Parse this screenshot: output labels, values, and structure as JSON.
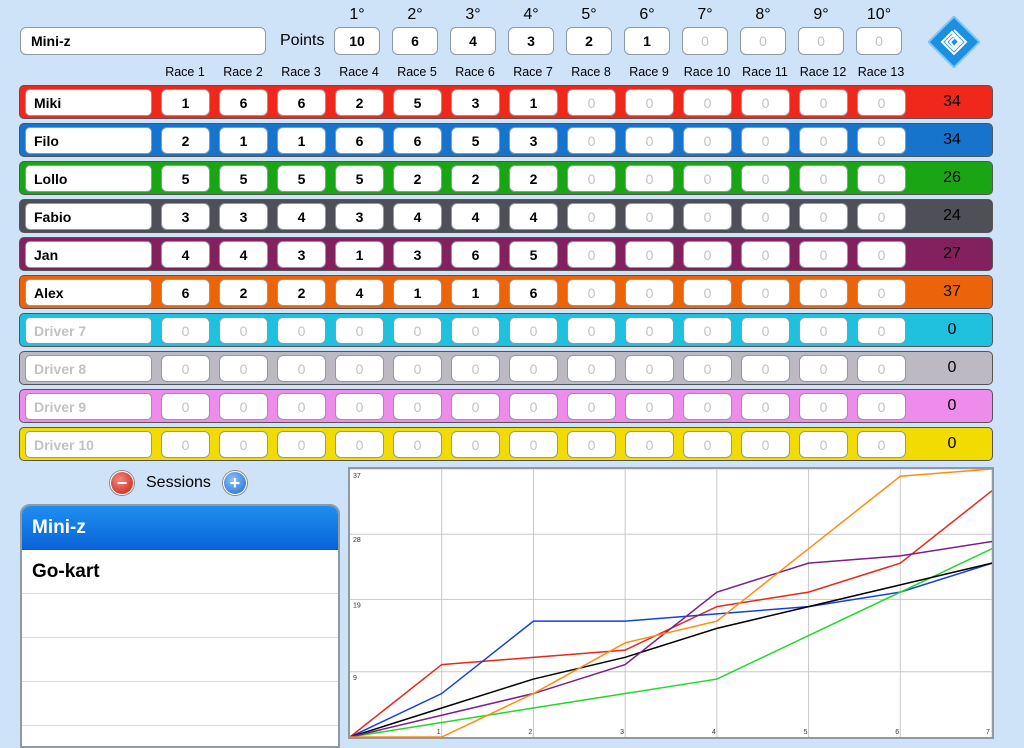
{
  "session": {
    "name": "Mini-z"
  },
  "points": {
    "label": "Points",
    "positions": [
      "1°",
      "2°",
      "3°",
      "4°",
      "5°",
      "6°",
      "7°",
      "8°",
      "9°",
      "10°"
    ],
    "values": [
      "10",
      "6",
      "4",
      "3",
      "2",
      "1",
      "0",
      "0",
      "0",
      "0"
    ]
  },
  "races": [
    "Race 1",
    "Race 2",
    "Race 3",
    "Race 4",
    "Race 5",
    "Race 6",
    "Race 7",
    "Race 8",
    "Race 9",
    "Race 10",
    "Race 11",
    "Race 12",
    "Race 13"
  ],
  "drivers": [
    {
      "name": "Miki",
      "color": "#f0281c",
      "results": [
        "1",
        "6",
        "6",
        "2",
        "5",
        "3",
        "1",
        "0",
        "0",
        "0",
        "0",
        "0",
        "0"
      ],
      "total": "34",
      "placeholder": false
    },
    {
      "name": "Filo",
      "color": "#1774cc",
      "results": [
        "2",
        "1",
        "1",
        "6",
        "6",
        "5",
        "3",
        "0",
        "0",
        "0",
        "0",
        "0",
        "0"
      ],
      "total": "34",
      "placeholder": false
    },
    {
      "name": "Lollo",
      "color": "#19a514",
      "results": [
        "5",
        "5",
        "5",
        "5",
        "2",
        "2",
        "2",
        "0",
        "0",
        "0",
        "0",
        "0",
        "0"
      ],
      "total": "26",
      "placeholder": false
    },
    {
      "name": "Fabio",
      "color": "#4f4f57",
      "results": [
        "3",
        "3",
        "4",
        "3",
        "4",
        "4",
        "4",
        "0",
        "0",
        "0",
        "0",
        "0",
        "0"
      ],
      "total": "24",
      "placeholder": false
    },
    {
      "name": "Jan",
      "color": "#83215e",
      "results": [
        "4",
        "4",
        "3",
        "1",
        "3",
        "6",
        "5",
        "0",
        "0",
        "0",
        "0",
        "0",
        "0"
      ],
      "total": "27",
      "placeholder": false
    },
    {
      "name": "Alex",
      "color": "#eb6409",
      "results": [
        "6",
        "2",
        "2",
        "4",
        "1",
        "1",
        "6",
        "0",
        "0",
        "0",
        "0",
        "0",
        "0"
      ],
      "total": "37",
      "placeholder": false
    },
    {
      "name": "Driver 7",
      "color": "#20c1df",
      "results": [
        "0",
        "0",
        "0",
        "0",
        "0",
        "0",
        "0",
        "0",
        "0",
        "0",
        "0",
        "0",
        "0"
      ],
      "total": "0",
      "placeholder": true
    },
    {
      "name": "Driver 8",
      "color": "#bcb9c3",
      "results": [
        "0",
        "0",
        "0",
        "0",
        "0",
        "0",
        "0",
        "0",
        "0",
        "0",
        "0",
        "0",
        "0"
      ],
      "total": "0",
      "placeholder": true
    },
    {
      "name": "Driver 9",
      "color": "#ee8cec",
      "results": [
        "0",
        "0",
        "0",
        "0",
        "0",
        "0",
        "0",
        "0",
        "0",
        "0",
        "0",
        "0",
        "0"
      ],
      "total": "0",
      "placeholder": true
    },
    {
      "name": "Driver 10",
      "color": "#f2db00",
      "results": [
        "0",
        "0",
        "0",
        "0",
        "0",
        "0",
        "0",
        "0",
        "0",
        "0",
        "0",
        "0",
        "0"
      ],
      "total": "0",
      "placeholder": true
    }
  ],
  "sessions": {
    "label": "Sessions",
    "items": [
      "Mini-z",
      "Go-kart"
    ],
    "selected": "Mini-z"
  },
  "icons": {
    "remove": "minus-circle-icon",
    "add": "plus-circle-icon",
    "logo": "diamond-spiral-icon"
  },
  "chart_data": {
    "type": "line",
    "x": [
      0,
      1,
      2,
      3,
      4,
      5,
      6,
      7
    ],
    "xticks": [
      "1",
      "2",
      "3",
      "4",
      "5",
      "6",
      "7"
    ],
    "yticks": [
      "9",
      "19",
      "28",
      "37"
    ],
    "ylim": [
      0,
      37
    ],
    "xlim": [
      0,
      7
    ],
    "grid": true,
    "series": [
      {
        "color": "#e8281b",
        "values": [
          0,
          10,
          11,
          12,
          18,
          20,
          24,
          34
        ]
      },
      {
        "color": "#1540e0",
        "values": [
          0,
          6,
          16,
          16,
          17,
          18,
          20,
          24
        ]
      },
      {
        "color": "#22d82a",
        "values": [
          0,
          2,
          4,
          6,
          8,
          14,
          20,
          26
        ]
      },
      {
        "color": "#000000",
        "values": [
          0,
          4,
          8,
          11,
          15,
          18,
          21,
          24
        ]
      },
      {
        "color": "#7a1f8c",
        "values": [
          0,
          3,
          6,
          10,
          20,
          24,
          25,
          27
        ]
      },
      {
        "color": "#ff8c10",
        "values": [
          0,
          0,
          6,
          13,
          16,
          26,
          36,
          37
        ]
      }
    ]
  }
}
